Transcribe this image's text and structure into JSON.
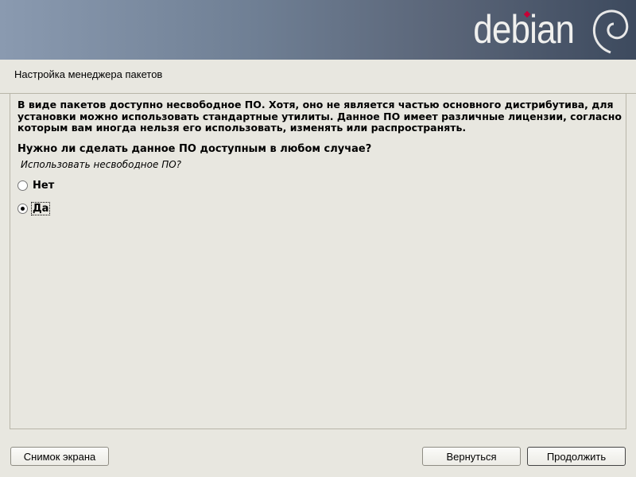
{
  "banner": {
    "logo": "debian"
  },
  "title": "Настройка менеджера пакетов",
  "description": [
    "В виде пакетов доступно несвободное ПО. Хотя, оно не является частью основного дистрибутива, для",
    "установки можно использовать стандартные утилиты. Данное ПО имеет различные лицензии, согласно",
    "которым вам иногда нельзя его использовать, изменять или распространять."
  ],
  "question": "Нужно ли сделать данное ПО доступным в любом случае?",
  "prompt": "Использовать несвободное ПО?",
  "options": [
    {
      "label": "Нет",
      "selected": false
    },
    {
      "label": "Да",
      "selected": true
    }
  ],
  "buttons": {
    "screenshot": "Снимок экрана",
    "back": "Вернуться",
    "continue": "Продолжить"
  }
}
